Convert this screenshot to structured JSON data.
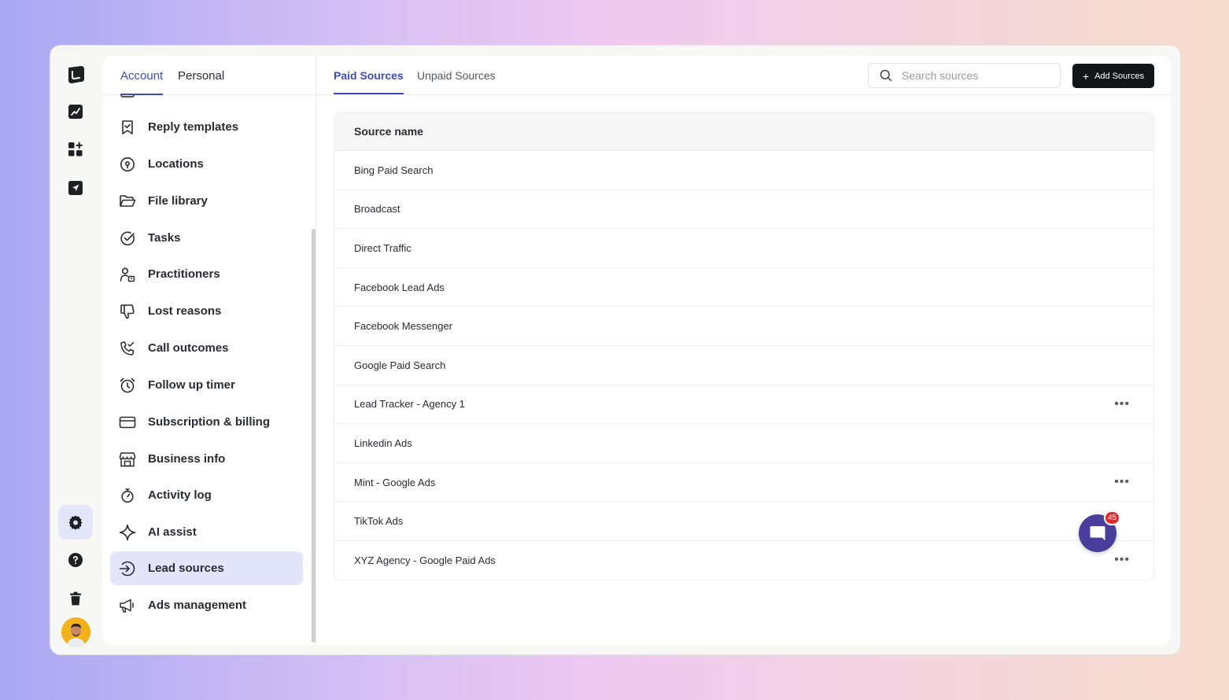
{
  "settings_nav": {
    "tabs": [
      {
        "label": "Account",
        "active": true
      },
      {
        "label": "Personal",
        "active": false
      }
    ],
    "items": [
      {
        "label": "Reply templates",
        "icon": "bookmark-check-icon"
      },
      {
        "label": "Locations",
        "icon": "map-pin-icon"
      },
      {
        "label": "File library",
        "icon": "folder-open-icon"
      },
      {
        "label": "Tasks",
        "icon": "check-circle-icon"
      },
      {
        "label": "Practitioners",
        "icon": "user-badge-icon"
      },
      {
        "label": "Lost reasons",
        "icon": "thumbs-down-icon"
      },
      {
        "label": "Call outcomes",
        "icon": "phone-check-icon"
      },
      {
        "label": "Follow up timer",
        "icon": "alarm-clock-icon"
      },
      {
        "label": "Subscription & billing",
        "icon": "credit-card-icon"
      },
      {
        "label": "Business info",
        "icon": "storefront-icon"
      },
      {
        "label": "Activity log",
        "icon": "stopwatch-icon"
      },
      {
        "label": "AI assist",
        "icon": "sparkle-icon"
      },
      {
        "label": "Lead sources",
        "icon": "sign-in-arrow-icon",
        "active": true
      },
      {
        "label": "Ads management",
        "icon": "megaphone-icon"
      }
    ]
  },
  "sources": {
    "tabs": [
      {
        "label": "Paid Sources",
        "active": true
      },
      {
        "label": "Unpaid Sources",
        "active": false
      }
    ],
    "search_placeholder": "Search sources",
    "add_label": "Add Sources",
    "column_header": "Source name",
    "rows": [
      {
        "name": "Bing Paid Search",
        "menu": false
      },
      {
        "name": "Broadcast",
        "menu": false
      },
      {
        "name": "Direct Traffic",
        "menu": false
      },
      {
        "name": "Facebook Lead Ads",
        "menu": false
      },
      {
        "name": "Facebook Messenger",
        "menu": false
      },
      {
        "name": "Google Paid Search",
        "menu": false
      },
      {
        "name": "Lead Tracker - Agency 1",
        "menu": true
      },
      {
        "name": "Linkedin Ads",
        "menu": false
      },
      {
        "name": "Mint - Google Ads",
        "menu": true
      },
      {
        "name": "TikTok Ads",
        "menu": false
      },
      {
        "name": "XYZ Agency - Google Paid Ads",
        "menu": true
      }
    ]
  },
  "chat": {
    "badge_count": "45"
  },
  "colors": {
    "accent": "#3f4ac0",
    "active_bg": "#e3e5fb",
    "button_dark": "#131418",
    "chat_bg": "#4b3d9c",
    "badge": "#e5252a"
  }
}
